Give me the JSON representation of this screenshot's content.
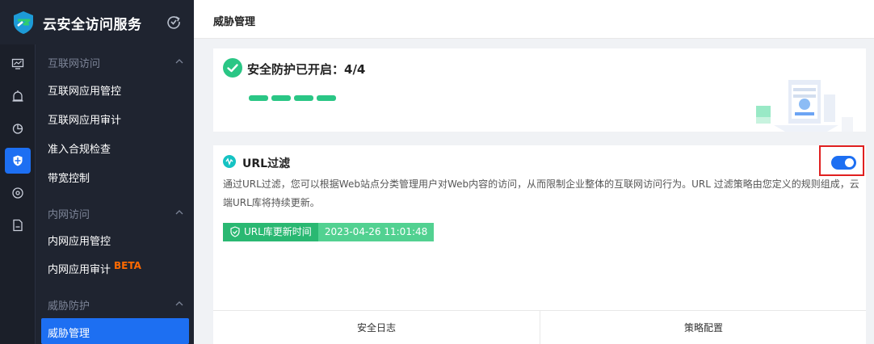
{
  "app": {
    "title": "云安全访问服务"
  },
  "sidebar": {
    "groups": [
      {
        "label": "互联网访问",
        "items": [
          "互联网应用管控",
          "互联网应用审计",
          "准入合规检查",
          "带宽控制"
        ]
      },
      {
        "label": "内网访问",
        "items": [
          "内网应用管控",
          "内网应用审计"
        ]
      },
      {
        "label": "威胁防护",
        "items": [
          "威胁管理"
        ]
      }
    ],
    "beta_badge": "BETA"
  },
  "header": {
    "title": "威胁管理"
  },
  "protection": {
    "status_text": "安全防护已开启：4/4",
    "enabled": 4,
    "total": 4
  },
  "url_filter": {
    "title": "URL过滤",
    "enabled": true,
    "description": "通过URL过滤，您可以根据Web站点分类管理用户对Web内容的访问，从而限制企业整体的互联网访问行为。URL 过滤策略由您定义的规则组成，云端URL库将持续更新。",
    "update_label": "URL库更新时间",
    "update_time": "2023-04-26 11:01:48",
    "footer": {
      "log": "安全日志",
      "policy": "策略配置"
    }
  },
  "colors": {
    "accent": "#1d6ff2",
    "success": "#2ac685",
    "sidebar_bg": "#1f2430",
    "highlight_border": "#e02020"
  }
}
